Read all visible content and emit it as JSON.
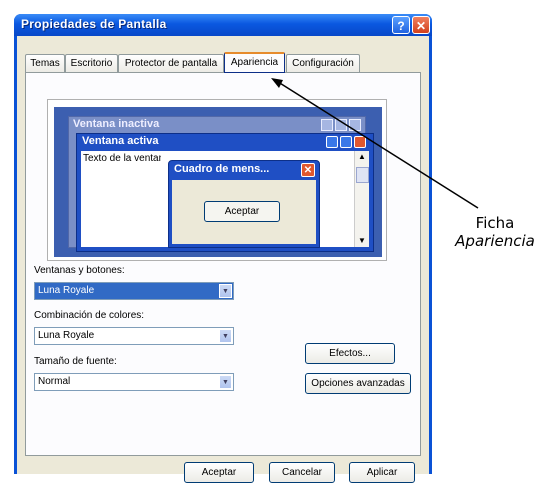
{
  "window": {
    "title": "Propiedades de Pantalla",
    "help_glyph": "?",
    "close_glyph": "✕"
  },
  "tabs": [
    {
      "label": "Temas"
    },
    {
      "label": "Escritorio"
    },
    {
      "label": "Protector de pantalla"
    },
    {
      "label": "Apariencia",
      "active": true
    },
    {
      "label": "Configuración"
    }
  ],
  "preview": {
    "inactive_title": "Ventana inactiva",
    "active_title": "Ventana activa",
    "window_text": "Texto de la ventana",
    "msgbox_title": "Cuadro de mens...",
    "msgbox_ok": "Aceptar"
  },
  "fields": {
    "windows_buttons_label": "Ventanas y botones:",
    "windows_buttons_value": "Luna Royale",
    "color_scheme_label": "Combinación de colores:",
    "color_scheme_value": "Luna Royale",
    "font_size_label": "Tamaño de fuente:",
    "font_size_value": "Normal"
  },
  "buttons": {
    "effects": "Efectos...",
    "advanced": "Opciones avanzadas",
    "ok": "Aceptar",
    "cancel": "Cancelar",
    "apply": "Aplicar"
  },
  "annotation": {
    "line1": "Ficha",
    "line2": "Apariencia"
  },
  "colors": {
    "titlebar": "#0a58e0",
    "selection": "#316ac5",
    "active_tab_accent": "#e68b2c"
  }
}
